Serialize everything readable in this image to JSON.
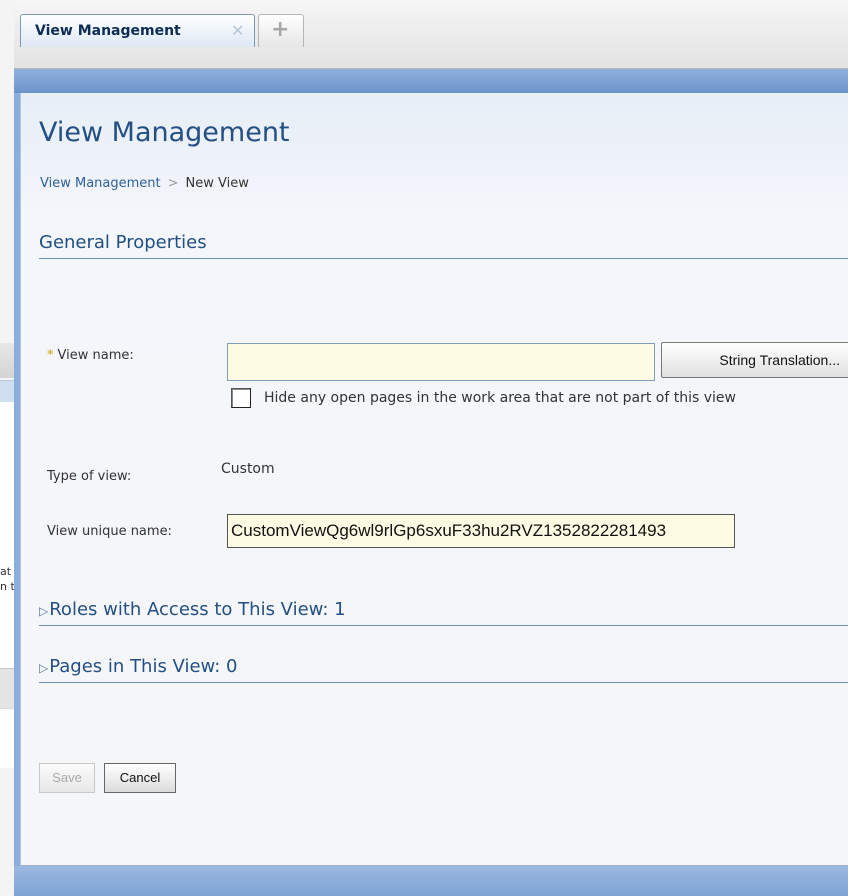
{
  "tabs": [
    {
      "label": "View Management",
      "close_icon": "close-icon",
      "active": true
    },
    {
      "add_icon": "plus-icon"
    }
  ],
  "background_fragments": [
    "at",
    "n t"
  ],
  "page": {
    "title": "View Management",
    "breadcrumb": {
      "link": "View Management",
      "separator": ">",
      "current": "New View"
    }
  },
  "general": {
    "section_title": "General Properties",
    "view_name": {
      "label": "View name:",
      "required_marker": "*",
      "value": "",
      "translation_button": "String Translation..."
    },
    "hide_pages": {
      "checked": false,
      "label": "Hide any open pages in the work area that are not part of this view"
    },
    "view_type": {
      "label": "Type of view:",
      "value": "Custom"
    },
    "unique_name": {
      "label": "View unique name:",
      "value": "CustomViewQg6wl9rlGp6sxuF33hu2RVZ1352822281493"
    }
  },
  "roles_section": {
    "arrow_icon": "triangle-right-icon",
    "title": "Roles with Access to This View: 1"
  },
  "pages_section": {
    "arrow_icon": "triangle-right-icon",
    "title": "Pages in This View: 0"
  },
  "actions": {
    "save_label": "Save",
    "save_enabled": false,
    "cancel_label": "Cancel"
  },
  "colors": {
    "title_blue": "#234f82",
    "band_blue": "#7ea3d4",
    "input_bg": "#fdfbe3",
    "required_marker": "#d4a000"
  }
}
